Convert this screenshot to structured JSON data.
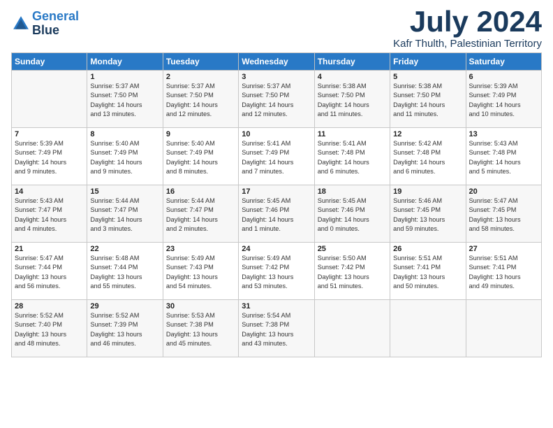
{
  "logo": {
    "line1": "General",
    "line2": "Blue"
  },
  "title": "July 2024",
  "location": "Kafr Thulth, Palestinian Territory",
  "days_header": [
    "Sunday",
    "Monday",
    "Tuesday",
    "Wednesday",
    "Thursday",
    "Friday",
    "Saturday"
  ],
  "weeks": [
    [
      {
        "num": "",
        "lines": []
      },
      {
        "num": "1",
        "lines": [
          "Sunrise: 5:37 AM",
          "Sunset: 7:50 PM",
          "Daylight: 14 hours",
          "and 13 minutes."
        ]
      },
      {
        "num": "2",
        "lines": [
          "Sunrise: 5:37 AM",
          "Sunset: 7:50 PM",
          "Daylight: 14 hours",
          "and 12 minutes."
        ]
      },
      {
        "num": "3",
        "lines": [
          "Sunrise: 5:37 AM",
          "Sunset: 7:50 PM",
          "Daylight: 14 hours",
          "and 12 minutes."
        ]
      },
      {
        "num": "4",
        "lines": [
          "Sunrise: 5:38 AM",
          "Sunset: 7:50 PM",
          "Daylight: 14 hours",
          "and 11 minutes."
        ]
      },
      {
        "num": "5",
        "lines": [
          "Sunrise: 5:38 AM",
          "Sunset: 7:50 PM",
          "Daylight: 14 hours",
          "and 11 minutes."
        ]
      },
      {
        "num": "6",
        "lines": [
          "Sunrise: 5:39 AM",
          "Sunset: 7:49 PM",
          "Daylight: 14 hours",
          "and 10 minutes."
        ]
      }
    ],
    [
      {
        "num": "7",
        "lines": [
          "Sunrise: 5:39 AM",
          "Sunset: 7:49 PM",
          "Daylight: 14 hours",
          "and 9 minutes."
        ]
      },
      {
        "num": "8",
        "lines": [
          "Sunrise: 5:40 AM",
          "Sunset: 7:49 PM",
          "Daylight: 14 hours",
          "and 9 minutes."
        ]
      },
      {
        "num": "9",
        "lines": [
          "Sunrise: 5:40 AM",
          "Sunset: 7:49 PM",
          "Daylight: 14 hours",
          "and 8 minutes."
        ]
      },
      {
        "num": "10",
        "lines": [
          "Sunrise: 5:41 AM",
          "Sunset: 7:49 PM",
          "Daylight: 14 hours",
          "and 7 minutes."
        ]
      },
      {
        "num": "11",
        "lines": [
          "Sunrise: 5:41 AM",
          "Sunset: 7:48 PM",
          "Daylight: 14 hours",
          "and 6 minutes."
        ]
      },
      {
        "num": "12",
        "lines": [
          "Sunrise: 5:42 AM",
          "Sunset: 7:48 PM",
          "Daylight: 14 hours",
          "and 6 minutes."
        ]
      },
      {
        "num": "13",
        "lines": [
          "Sunrise: 5:43 AM",
          "Sunset: 7:48 PM",
          "Daylight: 14 hours",
          "and 5 minutes."
        ]
      }
    ],
    [
      {
        "num": "14",
        "lines": [
          "Sunrise: 5:43 AM",
          "Sunset: 7:47 PM",
          "Daylight: 14 hours",
          "and 4 minutes."
        ]
      },
      {
        "num": "15",
        "lines": [
          "Sunrise: 5:44 AM",
          "Sunset: 7:47 PM",
          "Daylight: 14 hours",
          "and 3 minutes."
        ]
      },
      {
        "num": "16",
        "lines": [
          "Sunrise: 5:44 AM",
          "Sunset: 7:47 PM",
          "Daylight: 14 hours",
          "and 2 minutes."
        ]
      },
      {
        "num": "17",
        "lines": [
          "Sunrise: 5:45 AM",
          "Sunset: 7:46 PM",
          "Daylight: 14 hours",
          "and 1 minute."
        ]
      },
      {
        "num": "18",
        "lines": [
          "Sunrise: 5:45 AM",
          "Sunset: 7:46 PM",
          "Daylight: 14 hours",
          "and 0 minutes."
        ]
      },
      {
        "num": "19",
        "lines": [
          "Sunrise: 5:46 AM",
          "Sunset: 7:45 PM",
          "Daylight: 13 hours",
          "and 59 minutes."
        ]
      },
      {
        "num": "20",
        "lines": [
          "Sunrise: 5:47 AM",
          "Sunset: 7:45 PM",
          "Daylight: 13 hours",
          "and 58 minutes."
        ]
      }
    ],
    [
      {
        "num": "21",
        "lines": [
          "Sunrise: 5:47 AM",
          "Sunset: 7:44 PM",
          "Daylight: 13 hours",
          "and 56 minutes."
        ]
      },
      {
        "num": "22",
        "lines": [
          "Sunrise: 5:48 AM",
          "Sunset: 7:44 PM",
          "Daylight: 13 hours",
          "and 55 minutes."
        ]
      },
      {
        "num": "23",
        "lines": [
          "Sunrise: 5:49 AM",
          "Sunset: 7:43 PM",
          "Daylight: 13 hours",
          "and 54 minutes."
        ]
      },
      {
        "num": "24",
        "lines": [
          "Sunrise: 5:49 AM",
          "Sunset: 7:42 PM",
          "Daylight: 13 hours",
          "and 53 minutes."
        ]
      },
      {
        "num": "25",
        "lines": [
          "Sunrise: 5:50 AM",
          "Sunset: 7:42 PM",
          "Daylight: 13 hours",
          "and 51 minutes."
        ]
      },
      {
        "num": "26",
        "lines": [
          "Sunrise: 5:51 AM",
          "Sunset: 7:41 PM",
          "Daylight: 13 hours",
          "and 50 minutes."
        ]
      },
      {
        "num": "27",
        "lines": [
          "Sunrise: 5:51 AM",
          "Sunset: 7:41 PM",
          "Daylight: 13 hours",
          "and 49 minutes."
        ]
      }
    ],
    [
      {
        "num": "28",
        "lines": [
          "Sunrise: 5:52 AM",
          "Sunset: 7:40 PM",
          "Daylight: 13 hours",
          "and 48 minutes."
        ]
      },
      {
        "num": "29",
        "lines": [
          "Sunrise: 5:52 AM",
          "Sunset: 7:39 PM",
          "Daylight: 13 hours",
          "and 46 minutes."
        ]
      },
      {
        "num": "30",
        "lines": [
          "Sunrise: 5:53 AM",
          "Sunset: 7:38 PM",
          "Daylight: 13 hours",
          "and 45 minutes."
        ]
      },
      {
        "num": "31",
        "lines": [
          "Sunrise: 5:54 AM",
          "Sunset: 7:38 PM",
          "Daylight: 13 hours",
          "and 43 minutes."
        ]
      },
      {
        "num": "",
        "lines": []
      },
      {
        "num": "",
        "lines": []
      },
      {
        "num": "",
        "lines": []
      }
    ]
  ]
}
